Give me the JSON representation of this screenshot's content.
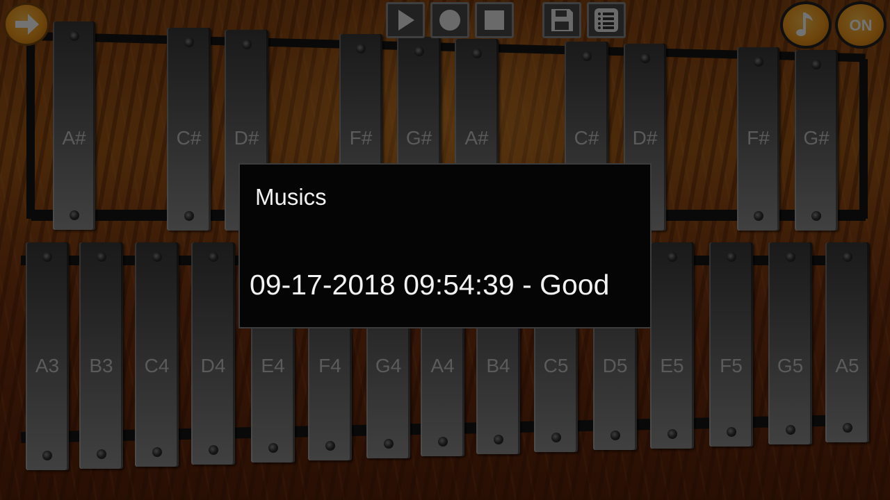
{
  "toolbar": {
    "left_icon": "arrow-right-icon",
    "play_icon": "play-icon",
    "record_icon": "record-icon",
    "stop_icon": "stop-icon",
    "save_icon": "floppy-disk-icon",
    "list_icon": "list-icon",
    "sound_icon": "music-note-icon",
    "power_label": "ON"
  },
  "sharps": [
    "A#",
    "C#",
    "D#",
    "F#",
    "G#",
    "A#",
    "C#",
    "D#",
    "F#",
    "G#"
  ],
  "naturals": [
    "A3",
    "B3",
    "C4",
    "D4",
    "E4",
    "F4",
    "G4",
    "A4",
    "B4",
    "C5",
    "D5",
    "E5",
    "F5",
    "G5",
    "A5"
  ],
  "dialog": {
    "title": "Musics",
    "items": [
      "09-17-2018 09:54:39 - Good"
    ]
  },
  "colors": {
    "accent_orange": "#f39a1c",
    "overlay_bg": "#050505",
    "dialog_text": "#f2f2f2"
  }
}
